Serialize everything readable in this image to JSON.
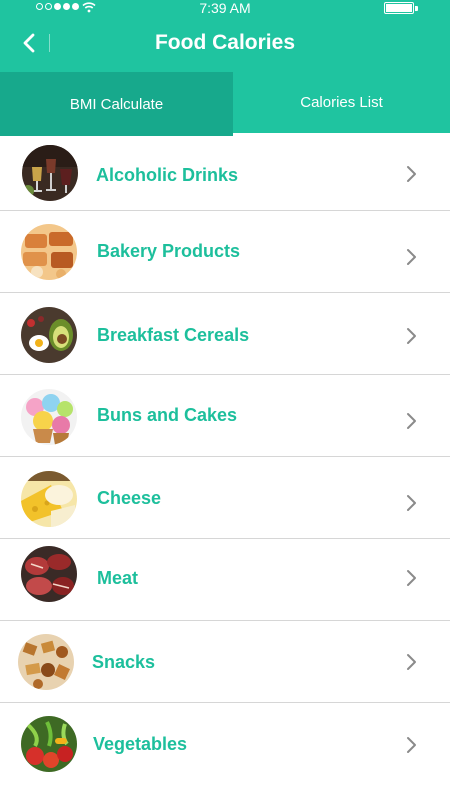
{
  "status_bar": {
    "time": "7:39 AM",
    "battery_level": 1.0,
    "signal_dots_filled": 3
  },
  "header": {
    "title": "Food Calories",
    "back_icon": "chevron-left-icon"
  },
  "tabs": [
    {
      "label": "BMI Calculate",
      "selected": false
    },
    {
      "label": "Calories List",
      "selected": true
    }
  ],
  "categories": [
    {
      "label": "Alcoholic Drinks",
      "icon": "alcoholic-drinks-thumbnail"
    },
    {
      "label": "Bakery Products",
      "icon": "bakery-products-thumbnail"
    },
    {
      "label": "Breakfast Cereals",
      "icon": "breakfast-cereals-thumbnail"
    },
    {
      "label": "Buns and Cakes",
      "icon": "buns-and-cakes-thumbnail"
    },
    {
      "label": "Cheese",
      "icon": "cheese-thumbnail"
    },
    {
      "label": "Meat",
      "icon": "meat-thumbnail"
    },
    {
      "label": "Snacks",
      "icon": "snacks-thumbnail"
    },
    {
      "label": "Vegetables",
      "icon": "vegetables-thumbnail"
    }
  ],
  "colors": {
    "accent": "#1fc4a0",
    "accent_dark": "#17a98c",
    "item_text": "#1dbf9c",
    "chevron": "#8a8a8a",
    "divider": "#d6d6d6"
  }
}
